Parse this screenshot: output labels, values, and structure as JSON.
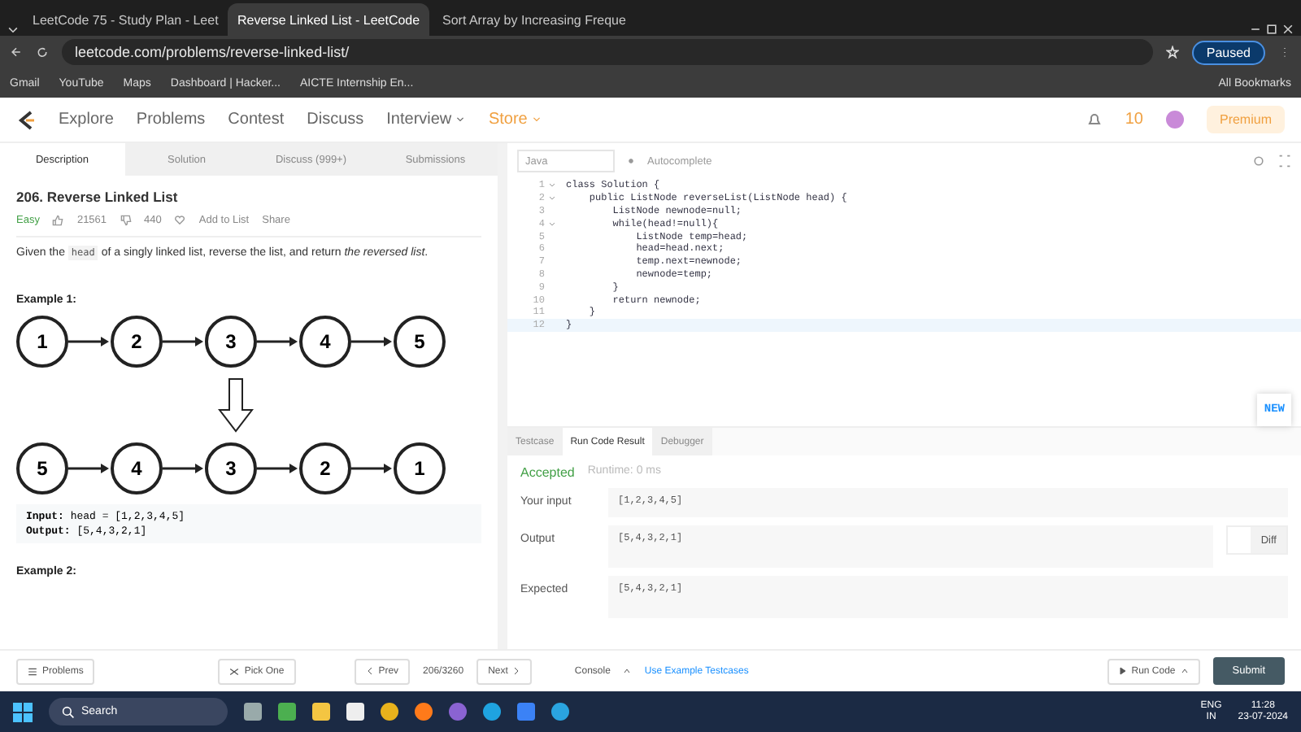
{
  "browser": {
    "tabs": [
      {
        "title": "LeetCode 75 - Study Plan - Leet",
        "selected": false
      },
      {
        "title": "Reverse Linked List - LeetCode",
        "selected": true
      },
      {
        "title": "Sort Array by Increasing Freque",
        "selected": false
      }
    ],
    "url": "leetcode.com/problems/reverse-linked-list/",
    "profile": "Paused",
    "bookmarks": [
      "Gmail",
      "YouTube",
      "Maps",
      "Dashboard | Hacker...",
      "AICTE Internship En..."
    ],
    "all_bookmarks": "All Bookmarks"
  },
  "nav": {
    "items": [
      {
        "label": "Explore",
        "kind": "link"
      },
      {
        "label": "Problems",
        "kind": "link"
      },
      {
        "label": "Contest",
        "kind": "link"
      },
      {
        "label": "Discuss",
        "kind": "link"
      },
      {
        "label": "Interview",
        "kind": "menu"
      },
      {
        "label": "Store",
        "kind": "store"
      }
    ],
    "streak": "10",
    "premium": "Premium"
  },
  "problem_tabs": [
    {
      "label": "Description",
      "selected": true
    },
    {
      "label": "Solution",
      "selected": false
    },
    {
      "label": "Discuss (999+)",
      "selected": false
    },
    {
      "label": "Submissions",
      "selected": false
    }
  ],
  "problem": {
    "title": "206. Reverse Linked List",
    "difficulty": "Easy",
    "likes": "21561",
    "dislikes": "440",
    "add_to_list": "Add to List",
    "share": "Share",
    "statement": [
      "Given the ",
      "head",
      " of a singly linked list, reverse the list, and return ",
      "the reversed list",
      "."
    ],
    "example1": "Example 1:",
    "list_before": [
      "1",
      "2",
      "3",
      "4",
      "5"
    ],
    "list_after": [
      "5",
      "4",
      "3",
      "2",
      "1"
    ],
    "input_label": "Input:",
    "input_value": "head = [1,2,3,4,5]",
    "output_label": "Output:",
    "output_value": "[5,4,3,2,1]",
    "example2": "Example 2:"
  },
  "editor": {
    "language": "Java",
    "autocomplete": "Autocomplete",
    "lines": [
      {
        "n": "1",
        "fold": true,
        "code": "class Solution {"
      },
      {
        "n": "2",
        "fold": true,
        "code": "    public ListNode reverseList(ListNode head) {"
      },
      {
        "n": "3",
        "fold": false,
        "code": "        ListNode newnode=null;"
      },
      {
        "n": "4",
        "fold": true,
        "code": "        while(head!=null){"
      },
      {
        "n": "5",
        "fold": false,
        "code": "            ListNode temp=head;"
      },
      {
        "n": "6",
        "fold": false,
        "code": "            head=head.next;"
      },
      {
        "n": "7",
        "fold": false,
        "code": "            temp.next=newnode;"
      },
      {
        "n": "8",
        "fold": false,
        "code": "            newnode=temp;"
      },
      {
        "n": "9",
        "fold": false,
        "code": "        }"
      },
      {
        "n": "10",
        "fold": false,
        "code": "        return newnode;"
      },
      {
        "n": "11",
        "fold": false,
        "code": "    }"
      },
      {
        "n": "12",
        "fold": false,
        "code": "}"
      }
    ],
    "new_badge": "NEW"
  },
  "console_tabs": [
    {
      "label": "Testcase",
      "selected": false
    },
    {
      "label": "Run Code Result",
      "selected": true
    },
    {
      "label": "Debugger",
      "selected": false
    }
  ],
  "result": {
    "status": "Accepted",
    "runtime": "Runtime: 0 ms",
    "rows": [
      {
        "label": "Your input",
        "value": "[1,2,3,4,5]"
      },
      {
        "label": "Output",
        "value": "[5,4,3,2,1]"
      },
      {
        "label": "Expected",
        "value": "[5,4,3,2,1]"
      }
    ],
    "diff": {
      "label": "Diff",
      "on": false
    }
  },
  "footer": {
    "problems": "Problems",
    "pick_one": "Pick One",
    "prev": "Prev",
    "counter": "206/3260",
    "next": "Next",
    "console": "Console",
    "use_example": "Use Example Testcases",
    "run_code": "Run Code",
    "submit": "Submit"
  },
  "taskbar": {
    "search": "Search",
    "lang": "ENG",
    "region": "IN",
    "time": "11:28",
    "date": "23-07-2024"
  }
}
